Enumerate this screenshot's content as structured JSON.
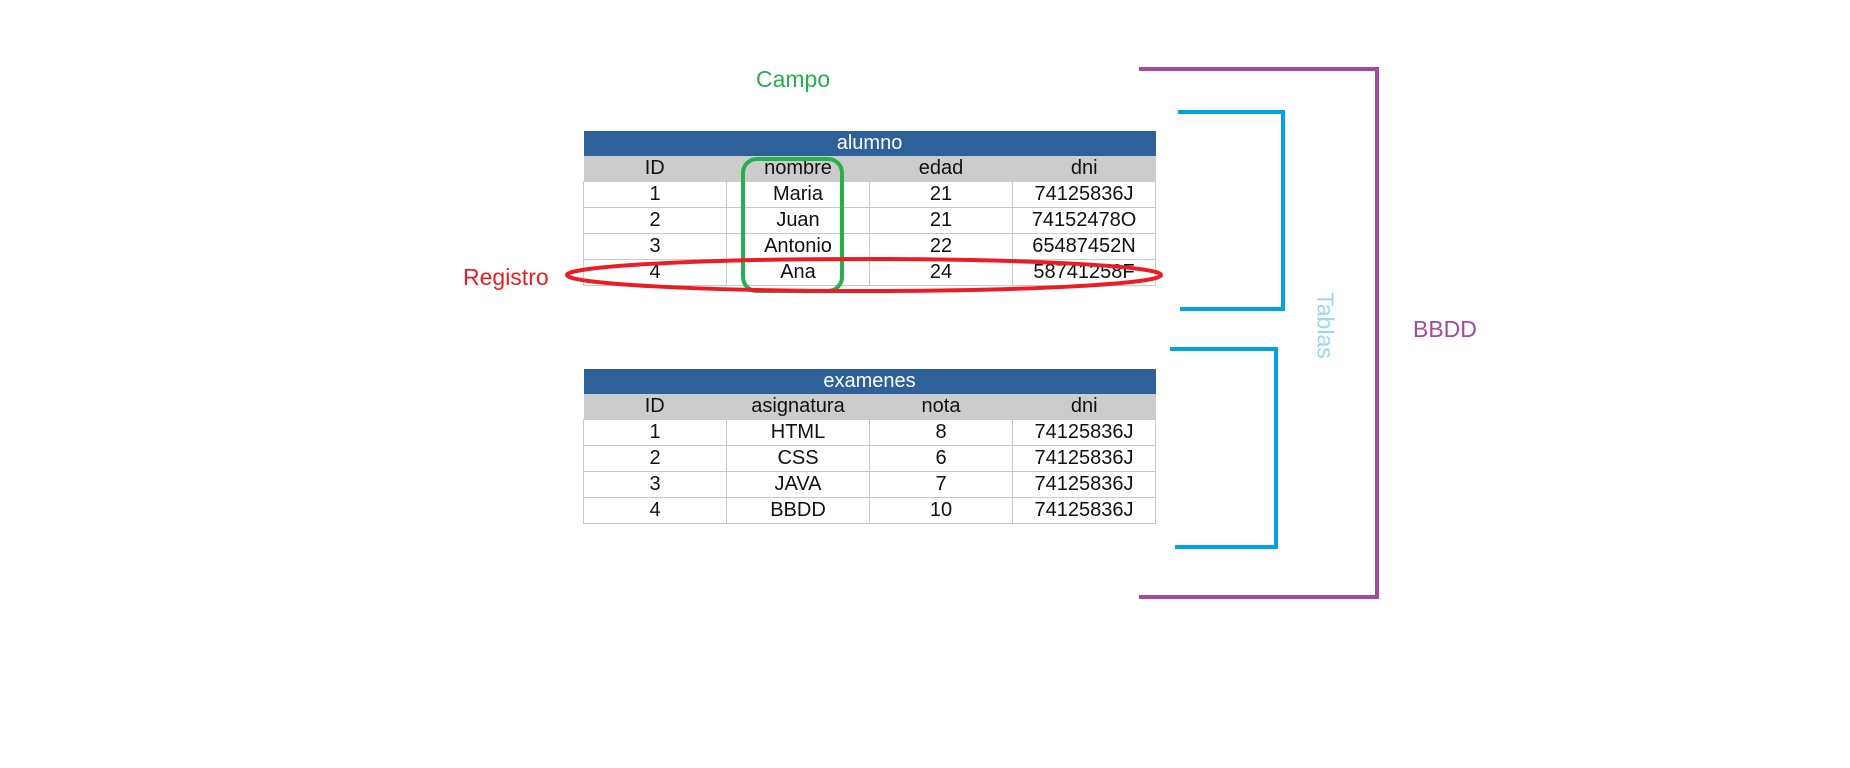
{
  "colors": {
    "campo": "#22b14c",
    "registro": "#ed1c24",
    "tablas": "#00a2e8",
    "tablas_text": "#99d9ea",
    "bbdd": "#a349a4",
    "table_title_bg": "#2e6099",
    "table_header_bg": "#cccccc"
  },
  "labels": {
    "campo": "Campo",
    "registro": "Registro",
    "tablas": "Tablas",
    "bbdd": "BBDD"
  },
  "tables": [
    {
      "title": "alumno",
      "headers": [
        "ID",
        "nombre",
        "edad",
        "dni"
      ],
      "rows": [
        [
          "1",
          "Maria",
          "21",
          "74125836J"
        ],
        [
          "2",
          "Juan",
          "21",
          "74152478O"
        ],
        [
          "3",
          "Antonio",
          "22",
          "65487452N"
        ],
        [
          "4",
          "Ana",
          "24",
          "58741258F"
        ]
      ]
    },
    {
      "title": "examenes",
      "headers": [
        "ID",
        "asignatura",
        "nota",
        "dni"
      ],
      "rows": [
        [
          "1",
          "HTML",
          "8",
          "74125836J"
        ],
        [
          "2",
          "CSS",
          "6",
          "74125836J"
        ],
        [
          "3",
          "JAVA",
          "7",
          "74125836J"
        ],
        [
          "4",
          "BBDD",
          "10",
          "74125836J"
        ]
      ]
    }
  ]
}
